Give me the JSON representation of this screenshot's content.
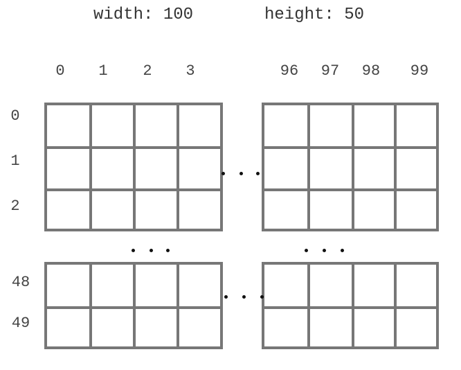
{
  "title": {
    "width_label": "width: 100",
    "height_label": "height: 50"
  },
  "column_labels": {
    "left": [
      "0",
      "1",
      "2",
      "3"
    ],
    "right": [
      "96",
      "97",
      "98",
      "99"
    ]
  },
  "row_labels": {
    "top": [
      "0",
      "1",
      "2"
    ],
    "bottom": [
      "48",
      "49"
    ]
  },
  "ellipsis": "..."
}
